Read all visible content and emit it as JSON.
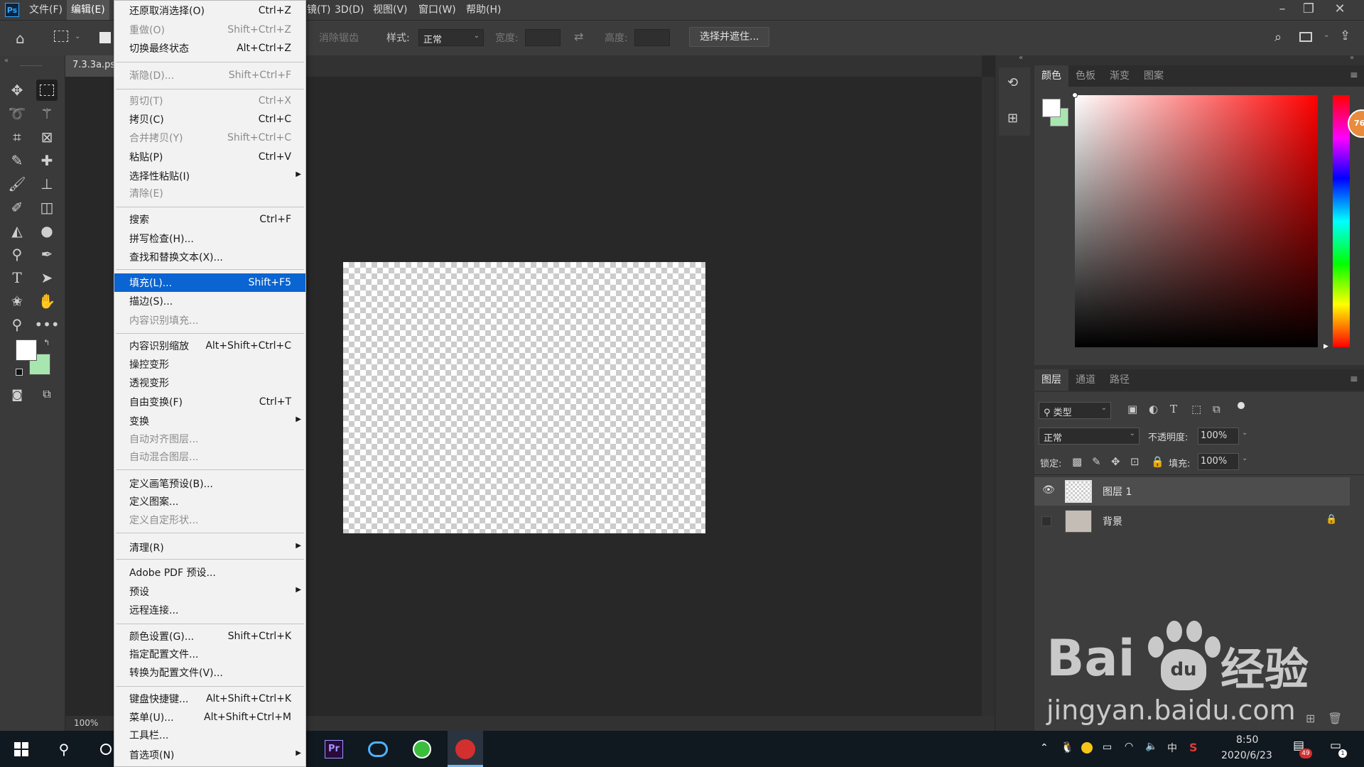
{
  "app": {
    "logo": "Ps",
    "menus": [
      "文件(F)",
      "编辑(E)",
      "滤镜(T)",
      "3D(D)",
      "视图(V)",
      "窗口(W)",
      "帮助(H)"
    ],
    "visible_menus": [
      "文件(F)",
      "编辑(E)",
      "3D(D)",
      "视图(V)",
      "窗口(W)",
      "帮助(H)"
    ],
    "menu_fragment": "镜(T)"
  },
  "options_bar": {
    "anti_alias_label": "消除锯齿",
    "style_label": "样式:",
    "style_value": "正常",
    "width_label": "宽度:",
    "height_label": "高度:",
    "select_mask_button": "选择并遮住..."
  },
  "document": {
    "tab_title": "7.3.3a.ps",
    "zoom": "100%"
  },
  "edit_menu": {
    "items": [
      {
        "label": "还原取消选择(O)",
        "shortcut": "Ctrl+Z",
        "disabled": false
      },
      {
        "label": "重做(O)",
        "shortcut": "Shift+Ctrl+Z",
        "disabled": true
      },
      {
        "label": "切换最终状态",
        "shortcut": "Alt+Ctrl+Z",
        "disabled": false
      },
      {
        "label": "渐隐(D)...",
        "shortcut": "Shift+Ctrl+F",
        "disabled": true
      },
      {
        "label": "剪切(T)",
        "shortcut": "Ctrl+X",
        "disabled": true
      },
      {
        "label": "拷贝(C)",
        "shortcut": "Ctrl+C",
        "disabled": false
      },
      {
        "label": "合并拷贝(Y)",
        "shortcut": "Shift+Ctrl+C",
        "disabled": true
      },
      {
        "label": "粘贴(P)",
        "shortcut": "Ctrl+V",
        "disabled": false
      },
      {
        "label": "选择性粘贴(I)",
        "shortcut": "",
        "disabled": false,
        "submenu": true
      },
      {
        "label": "清除(E)",
        "shortcut": "",
        "disabled": true
      },
      {
        "label": "搜索",
        "shortcut": "Ctrl+F",
        "disabled": false
      },
      {
        "label": "拼写检查(H)...",
        "shortcut": "",
        "disabled": false
      },
      {
        "label": "查找和替换文本(X)...",
        "shortcut": "",
        "disabled": false
      },
      {
        "label": "填充(L)...",
        "shortcut": "Shift+F5",
        "disabled": false,
        "highlighted": true
      },
      {
        "label": "描边(S)...",
        "shortcut": "",
        "disabled": false
      },
      {
        "label": "内容识别填充...",
        "shortcut": "",
        "disabled": true
      },
      {
        "label": "内容识别缩放",
        "shortcut": "Alt+Shift+Ctrl+C",
        "disabled": false
      },
      {
        "label": "操控变形",
        "shortcut": "",
        "disabled": false
      },
      {
        "label": "透视变形",
        "shortcut": "",
        "disabled": false
      },
      {
        "label": "自由变换(F)",
        "shortcut": "Ctrl+T",
        "disabled": false
      },
      {
        "label": "变换",
        "shortcut": "",
        "disabled": false,
        "submenu": true
      },
      {
        "label": "自动对齐图层...",
        "shortcut": "",
        "disabled": true
      },
      {
        "label": "自动混合图层...",
        "shortcut": "",
        "disabled": true
      },
      {
        "label": "定义画笔预设(B)...",
        "shortcut": "",
        "disabled": false
      },
      {
        "label": "定义图案...",
        "shortcut": "",
        "disabled": false
      },
      {
        "label": "定义自定形状...",
        "shortcut": "",
        "disabled": true
      },
      {
        "label": "清理(R)",
        "shortcut": "",
        "disabled": false,
        "submenu": true
      },
      {
        "label": "Adobe PDF 预设...",
        "shortcut": "",
        "disabled": false
      },
      {
        "label": "预设",
        "shortcut": "",
        "disabled": false,
        "submenu": true
      },
      {
        "label": "远程连接...",
        "shortcut": "",
        "disabled": false
      },
      {
        "label": "颜色设置(G)...",
        "shortcut": "Shift+Ctrl+K",
        "disabled": false
      },
      {
        "label": "指定配置文件...",
        "shortcut": "",
        "disabled": false
      },
      {
        "label": "转换为配置文件(V)...",
        "shortcut": "",
        "disabled": false
      },
      {
        "label": "键盘快捷键...",
        "shortcut": "Alt+Shift+Ctrl+K",
        "disabled": false
      },
      {
        "label": "菜单(U)...",
        "shortcut": "Alt+Shift+Ctrl+M",
        "disabled": false
      },
      {
        "label": "工具栏...",
        "shortcut": "",
        "disabled": false
      },
      {
        "label": "首选项(N)",
        "shortcut": "",
        "disabled": false,
        "submenu": true
      }
    ]
  },
  "color_panel": {
    "tabs": [
      "颜色",
      "色板",
      "渐变",
      "图案"
    ],
    "active_tab": "颜色",
    "badge": "76",
    "foreground_color": "#ffffff",
    "background_color": "#a8e6b0"
  },
  "layers_panel": {
    "tabs": [
      "图层",
      "通道",
      "路径"
    ],
    "active_tab": "图层",
    "filter_label": "类型",
    "blend_mode": "正常",
    "opacity_label": "不透明度:",
    "opacity_value": "100%",
    "lock_label": "锁定:",
    "fill_label": "填充:",
    "fill_value": "100%",
    "layers": [
      {
        "name": "图层 1",
        "visible": true,
        "selected": true,
        "locked": false
      },
      {
        "name": "背景",
        "visible": false,
        "selected": false,
        "locked": true
      }
    ]
  },
  "taskbar": {
    "time": "8:50",
    "date": "2020/6/23",
    "ime": "中",
    "notification_count": "49",
    "message_count": "1",
    "pinned": [
      "premiere-pro",
      "baidu-netdisk",
      "360-browser",
      "app-red"
    ]
  },
  "watermark": {
    "brand_left": "Bai",
    "brand_right": "经验",
    "paw_text": "du",
    "url": "jingyan.baidu.com"
  }
}
